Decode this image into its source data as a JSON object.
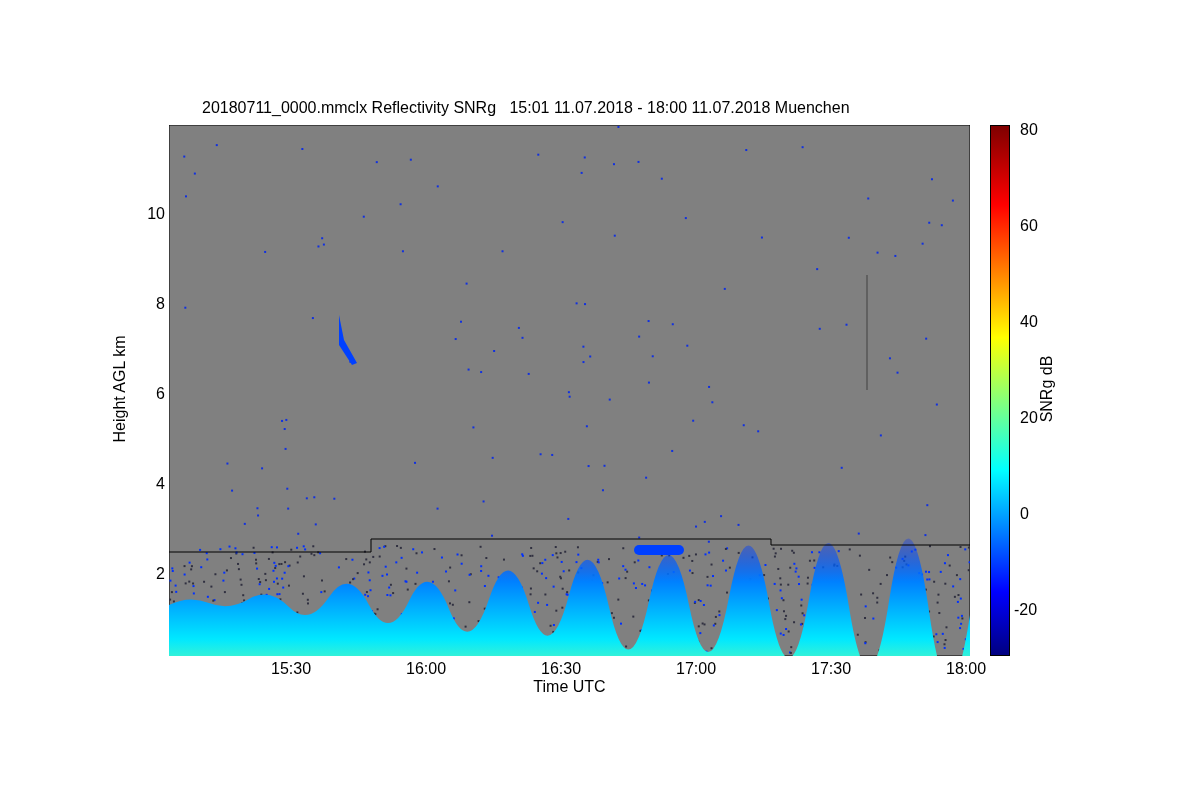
{
  "title": "20180711_0000.mmclx Reflectivity SNRg   15:01 11.07.2018 - 18:00 11.07.2018 Muenchen",
  "plot": {
    "xlabel": "Time UTC",
    "ylabel": "Height AGL km",
    "xticks": [
      "15:30",
      "16:00",
      "16:30",
      "17:00",
      "17:30",
      "18:00"
    ],
    "yticks": [
      "10",
      "8",
      "6",
      "4",
      "2"
    ]
  },
  "colorbar": {
    "label": "SNRg dB",
    "ticks": [
      "80",
      "60",
      "40",
      "20",
      "0",
      "-20"
    ]
  }
}
